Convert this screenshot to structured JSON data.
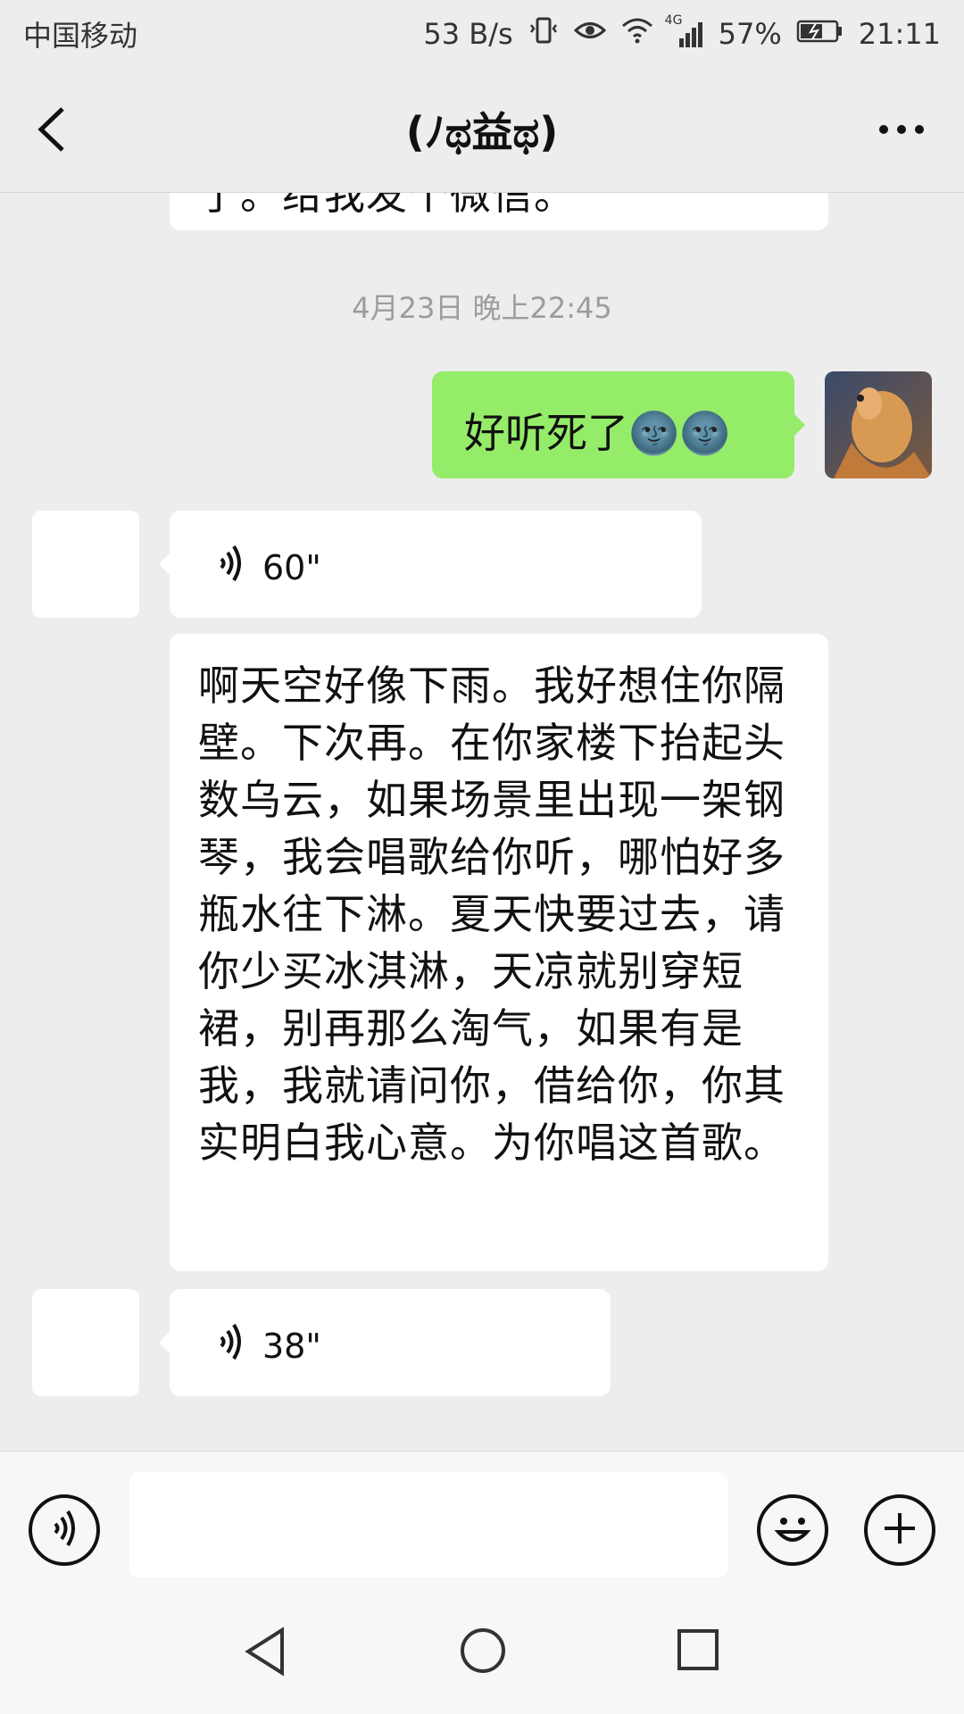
{
  "status_bar": {
    "carrier": "中国移动",
    "speed": "53 B/s",
    "network": "4G",
    "battery": "57%",
    "time": "21:11"
  },
  "nav": {
    "title": "(ﾉಥ益ಥ)"
  },
  "chat": {
    "partial_message": "了。给我发个微信。",
    "timestamp": "4月23日 晚上22:45",
    "my_message": "好听死了🌚🌚",
    "voice_1": "60\"",
    "transcript": "啊天空好像下雨。我好想住你隔壁。下次再。在你家楼下抬起头数乌云，如果场景里出现一架钢琴，我会唱歌给你听，哪怕好多瓶水往下淋。夏天快要过去，请你少买冰淇淋，天凉就别穿短裙，别再那么淘气，如果有是我，我就请问你，借给你，你其实明白我心意。为你唱这首歌。",
    "voice_2": "38\""
  },
  "icons": {
    "back": "back-icon",
    "more": "more-icon",
    "voice": "voice-icon",
    "emoji": "emoji-icon",
    "add": "add-icon"
  },
  "colors": {
    "my_bubble": "#95ec69",
    "background": "#ededed"
  }
}
